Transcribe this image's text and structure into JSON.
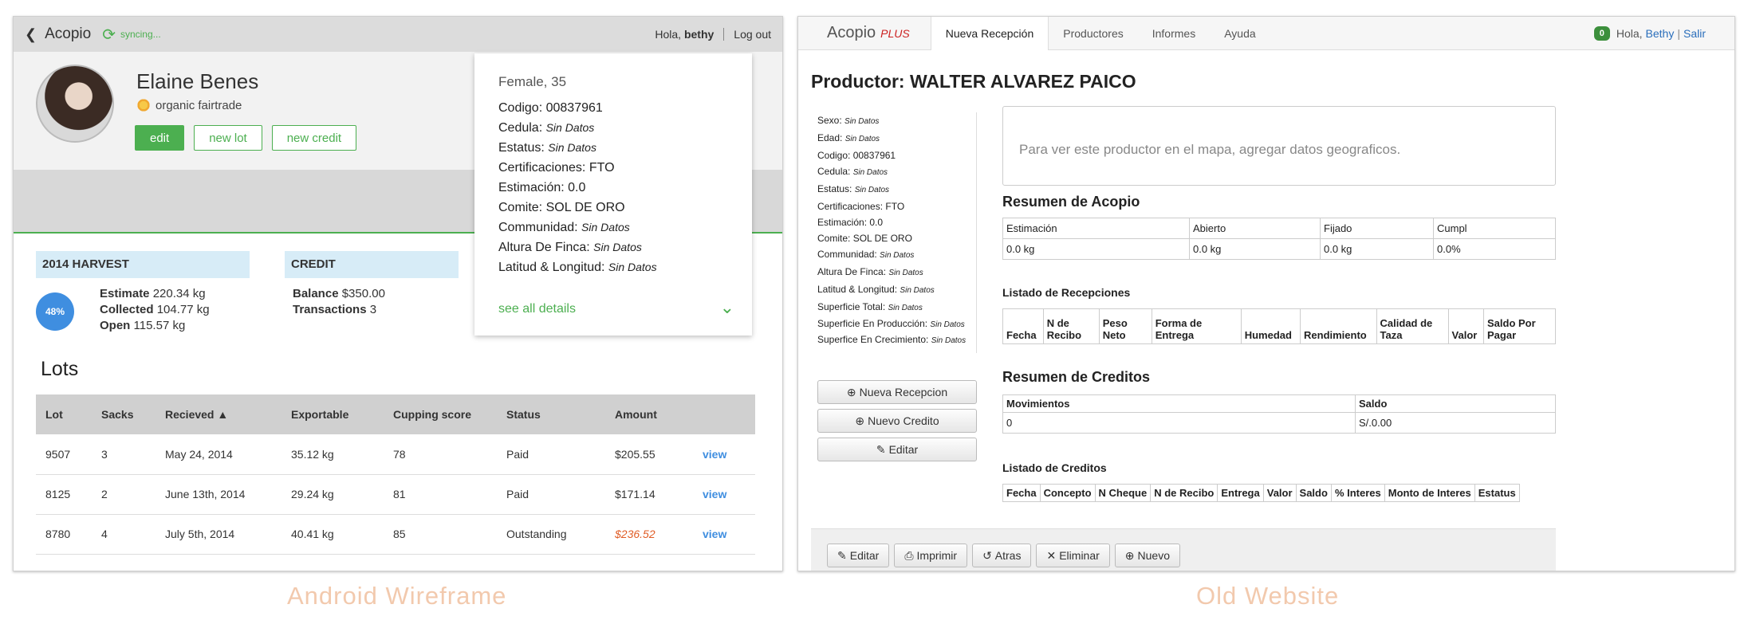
{
  "android": {
    "topbar": {
      "back_icon": "chevron-left-icon",
      "app_title": "Acopio",
      "sync_icon": "sync-icon",
      "sync_text": "syncing...",
      "hola_prefix": "Hola, ",
      "hola_user": "bethy",
      "logout": "Log out"
    },
    "profile": {
      "name": "Elaine Benes",
      "cert_icon": "sun-icon",
      "cert_text": "organic fairtrade",
      "buttons": {
        "edit": "edit",
        "new_lot": "new lot",
        "new_credit": "new credit"
      }
    },
    "details_card": {
      "summary": "Female, 35",
      "rows": [
        {
          "label": "Codigo: ",
          "value": "00837961",
          "italic": false
        },
        {
          "label": "Cedula: ",
          "value": "Sin Datos",
          "italic": true
        },
        {
          "label": "Estatus: ",
          "value": "Sin Datos",
          "italic": true
        },
        {
          "label": "Certificaciones: ",
          "value": "FTO",
          "italic": false
        },
        {
          "label": "Estimación: ",
          "value": "0.0",
          "italic": false
        },
        {
          "label": "Comite: ",
          "value": "SOL DE ORO",
          "italic": false
        },
        {
          "label": "Communidad: ",
          "value": "Sin Datos",
          "italic": true
        },
        {
          "label": "Altura De Finca: ",
          "value": "Sin Datos",
          "italic": true
        },
        {
          "label": "Latitud & Longitud: ",
          "value": "Sin Datos",
          "italic": true
        }
      ],
      "see_all": "see all details",
      "chevron_icon": "chevron-down-icon"
    },
    "harvest": {
      "title": "2014 HARVEST",
      "percent": "48%",
      "estimate_label": "Estimate",
      "estimate": "220.34 kg",
      "collected_label": "Collected",
      "collected": "104.77 kg",
      "open_label": "Open",
      "open": "115.57 kg"
    },
    "credit": {
      "title": "CREDIT",
      "balance_label": "Balance",
      "balance": "$350.00",
      "transactions_label": "Transactions",
      "transactions": "3"
    },
    "lots": {
      "title": "Lots",
      "headers": [
        "Lot",
        "Sacks",
        "Recieved ▲",
        "Exportable",
        "Cupping score",
        "Status",
        "Amount",
        ""
      ],
      "rows": [
        {
          "lot": "9507",
          "sacks": "3",
          "received": "May 24, 2014",
          "exportable": "35.12 kg",
          "score": "78",
          "status": "Paid",
          "amount": "$205.55",
          "view": "view"
        },
        {
          "lot": "8125",
          "sacks": "2",
          "received": "June 13th, 2014",
          "exportable": "29.24 kg",
          "score": "81",
          "status": "Paid",
          "amount": "$171.14",
          "view": "view"
        },
        {
          "lot": "8780",
          "sacks": "4",
          "received": "July 5th, 2014",
          "exportable": "40.41 kg",
          "score": "85",
          "status": "Outstanding",
          "amount": "$236.52",
          "view": "view"
        }
      ]
    },
    "caption": "Android Wireframe"
  },
  "web": {
    "nav": {
      "brand": "Acopio",
      "brand_plus": "PLUS",
      "items": [
        "Nueva Recepción",
        "Productores",
        "Informes",
        "Ayuda"
      ],
      "badge": "0",
      "hola": "Hola,",
      "user": "Bethy",
      "sep": "|",
      "salir": "Salir"
    },
    "title": "Productor: WALTER ALVAREZ PAICO",
    "attrs": [
      {
        "label": "Sexo: ",
        "value": "Sin Datos",
        "italic": true
      },
      {
        "label": "Edad: ",
        "value": "Sin Datos",
        "italic": true
      },
      {
        "label": "Codigo: ",
        "value": "00837961",
        "italic": false
      },
      {
        "label": "Cedula: ",
        "value": "Sin Datos",
        "italic": true
      },
      {
        "label": "Estatus: ",
        "value": "Sin Datos",
        "italic": true
      },
      {
        "label": "Certificaciones: ",
        "value": "FTO",
        "italic": false
      },
      {
        "label": "Estimación: ",
        "value": "0.0",
        "italic": false
      },
      {
        "label": "Comite: ",
        "value": "SOL DE ORO",
        "italic": false
      },
      {
        "label": "Communidad: ",
        "value": "Sin Datos",
        "italic": true
      },
      {
        "label": "Altura De Finca: ",
        "value": "Sin Datos",
        "italic": true
      },
      {
        "label": "Latitud & Longitud: ",
        "value": "Sin Datos",
        "italic": true
      },
      {
        "label": "Superficie Total: ",
        "value": "Sin Datos",
        "italic": true
      },
      {
        "label": "Superficie En Producción: ",
        "value": "Sin Datos",
        "italic": true
      },
      {
        "label": "Superfice En Crecimiento: ",
        "value": "Sin Datos",
        "italic": true
      }
    ],
    "side_buttons": {
      "nueva_recepcion": "Nueva Recepcion",
      "nuevo_credito": "Nuevo Credito",
      "editar": "Editar"
    },
    "map_text": "Para ver este productor en el mapa, agregar datos geograficos.",
    "resumen_acopio": {
      "title": "Resumen de Acopio",
      "headers": [
        "Estimación",
        "Abierto",
        "Fijado",
        "Cumpl"
      ],
      "values": [
        "0.0 kg",
        "0.0 kg",
        "0.0 kg",
        "0.0%"
      ]
    },
    "recepciones": {
      "title": "Listado de Recepciones",
      "headers": [
        "Fecha",
        "N de Recibo",
        "Peso Neto",
        "Forma de Entrega",
        "Humedad",
        "Rendimiento",
        "Calidad de Taza",
        "Valor",
        "Saldo Por Pagar"
      ]
    },
    "resumen_creditos": {
      "title": "Resumen de Creditos",
      "headers": [
        "Movimientos",
        "Saldo"
      ],
      "values": [
        "0",
        "S/.0.00"
      ]
    },
    "creditos": {
      "title": "Listado de Creditos",
      "headers": [
        "Fecha",
        "Concepto",
        "N Cheque",
        "N de Recibo",
        "Entrega",
        "Valor",
        "Saldo",
        "% Interes",
        "Monto de Interes",
        "Estatus"
      ]
    },
    "footer": {
      "editar": "Editar",
      "imprimir": "Imprimir",
      "atras": "Atras",
      "eliminar": "Eliminar",
      "nuevo": "Nuevo"
    },
    "caption": "Old Website"
  }
}
